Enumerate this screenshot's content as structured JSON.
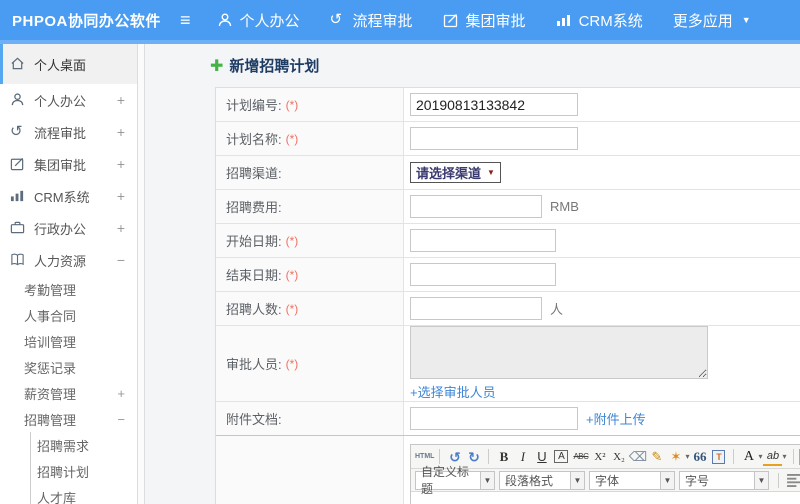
{
  "icons": {
    "hamburger": "≡",
    "caret_down": "▼",
    "process": "↺",
    "edit": "✎"
  },
  "topbar": {
    "logo": "PHPOA协同办公软件",
    "items": [
      {
        "label": "个人办公",
        "icon": "person-icon"
      },
      {
        "label": "流程审批",
        "icon": "workflow-icon"
      },
      {
        "label": "集团审批",
        "icon": "edit-icon"
      },
      {
        "label": "CRM系统",
        "icon": "bar-chart-icon"
      },
      {
        "label": "更多应用",
        "icon": "caret-down-icon"
      }
    ]
  },
  "sidebar": {
    "items": [
      {
        "label": "个人桌面",
        "icon": "home-icon",
        "active": true
      },
      {
        "label": "个人办公",
        "icon": "person-icon",
        "expander": "+"
      },
      {
        "label": "流程审批",
        "icon": "workflow-icon",
        "expander": "+"
      },
      {
        "label": "集团审批",
        "icon": "edit-icon",
        "expander": "+"
      },
      {
        "label": "CRM系统",
        "icon": "bar-chart-icon",
        "expander": "+"
      },
      {
        "label": "行政办公",
        "icon": "briefcase-icon",
        "expander": "+"
      },
      {
        "label": "人力资源",
        "icon": "book-icon",
        "expander": "−"
      }
    ],
    "hr_subitems": [
      {
        "label": "考勤管理"
      },
      {
        "label": "人事合同"
      },
      {
        "label": "培训管理"
      },
      {
        "label": "奖惩记录"
      },
      {
        "label": "薪资管理",
        "expander": "+"
      },
      {
        "label": "招聘管理",
        "expander": "−"
      }
    ],
    "recruit_subitems": [
      {
        "label": "招聘需求"
      },
      {
        "label": "招聘计划"
      },
      {
        "label": "人才库"
      }
    ]
  },
  "page": {
    "title": "新增招聘计划",
    "plus_icon": "✚"
  },
  "form": {
    "required_mark": "(*)",
    "rows": {
      "plan_no": {
        "label": "计划编号:",
        "value": "20190813133842"
      },
      "plan_name": {
        "label": "计划名称:",
        "value": ""
      },
      "channel": {
        "label": "招聘渠道:",
        "select_value": "请选择渠道",
        "caret": "▼"
      },
      "fee": {
        "label": "招聘费用:",
        "value": "",
        "suffix": "RMB"
      },
      "start_date": {
        "label": "开始日期:",
        "value": ""
      },
      "end_date": {
        "label": "结束日期:",
        "value": ""
      },
      "headcount": {
        "label": "招聘人数:",
        "value": "",
        "suffix": "人"
      },
      "approvers": {
        "label": "审批人员:",
        "link": "+选择审批人员"
      },
      "attachment": {
        "label": "附件文档:",
        "value": "",
        "link": "+附件上传"
      }
    }
  },
  "editor": {
    "toolbar1": {
      "html_btn": "HTML",
      "undo": "↺",
      "redo": "↻",
      "bold": "B",
      "italic": "I",
      "underline": "U",
      "boxed_a": "A",
      "strike": "ABC",
      "sup": "X²",
      "sub": "X₂",
      "eraser": "⌫",
      "brush": "✎",
      "wand": "✶",
      "quote": "66",
      "paste": "T",
      "font_color": "A",
      "highlight": "ab",
      "caret": "▾"
    },
    "toolbar2": {
      "dropdowns": [
        {
          "label": "自定义标题"
        },
        {
          "label": "段落格式"
        },
        {
          "label": "字体"
        },
        {
          "label": "字号"
        }
      ],
      "caret": "▼",
      "link_icon": "∞"
    }
  },
  "colors": {
    "topbar_blue": "#4a9cf2",
    "accent_blue": "#6db0f5",
    "link_blue": "#3e86d6",
    "title_navy": "#1e3c64",
    "required_red": "#ef7263",
    "plus_green": "#44b244"
  }
}
